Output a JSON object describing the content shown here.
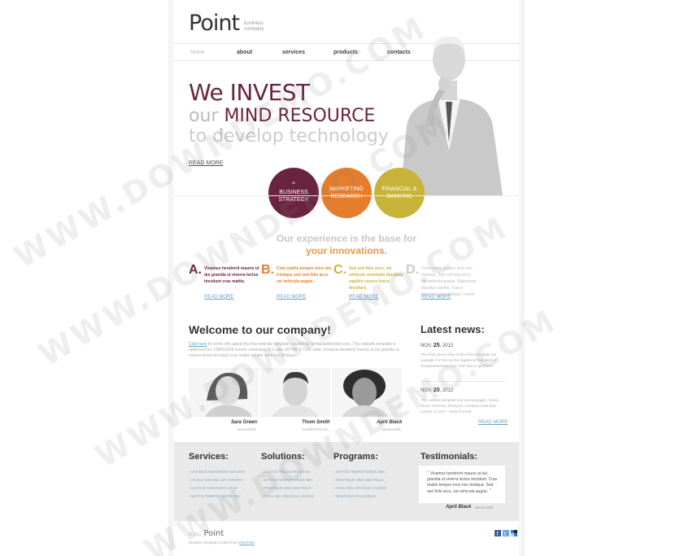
{
  "brand": {
    "name": "Point",
    "tagline": "business company"
  },
  "nav": [
    {
      "label": "home",
      "active": true
    },
    {
      "label": "about"
    },
    {
      "label": "services"
    },
    {
      "label": "products"
    },
    {
      "label": "contacts"
    }
  ],
  "hero": {
    "line1": "We INVEST",
    "line2_light": "our",
    "line2_accent": "MIND RESOURCE",
    "line3": "to develop technology",
    "read_more": "READ MORE"
  },
  "circles": [
    {
      "line1": "BUSINESS",
      "line2": "STRATEGY",
      "color": "#6b2440"
    },
    {
      "line1": "MARKETING",
      "line2": "RESEARCH",
      "color": "#e57e2c"
    },
    {
      "line1": "FINANCIAL &",
      "line2": "BANKING",
      "color": "#c9b23a"
    }
  ],
  "experience": {
    "title_part1": "Our experience is the base for",
    "title_part2": "your innovations.",
    "items": [
      {
        "letter": "A.",
        "text": "Vivamus hendrerit mauris ut dui gravida ut viverra lectus tincidunt cras mattis.",
        "read_more": "READ MORE",
        "color": "#6b2440"
      },
      {
        "letter": "B.",
        "text": "Cras mattis tempor eros nec tristique sed sed felis arcu vel vehicula augue.",
        "read_more": "READ MORE",
        "color": "#e57e2c"
      },
      {
        "letter": "C.",
        "text": "Sed sed felis arcu, vel vehicula venenatis faucibus sagittis cursus fusce tincidunt.",
        "read_more": "READ MORE",
        "color": "#c9b23a"
      },
      {
        "letter": "D.",
        "text": "Cras mattis tempor eros nec tristique. Sed sed felis arcu, vel vehicula augue. Maecenas faucibus lacinia. Fusce tincidunt eget tristique. Lorem.",
        "read_more": "READ MORE",
        "color": "#cccccc"
      }
    ]
  },
  "welcome": {
    "title": "Welcome to our company!",
    "link": "Click here",
    "text": "for more info about this free website template created by TemplateMonster.com. This website template is optimized for 1280X1024 screen resolution. It is also XHTML & CSS valid. Vivamus hendrerit mauris ut dui gravida ut viverra lectus tincidunt cras mattis tempor eros nec tristique."
  },
  "team": [
    {
      "name": "Sara Green",
      "role": "MANAGER"
    },
    {
      "name": "Thom Smith",
      "role": "MARKETOLOG"
    },
    {
      "name": "April Black",
      "role": "MANAGER"
    }
  ],
  "news": {
    "title": "Latest news:",
    "items": [
      {
        "month": "NOV.",
        "day": "25",
        "year": ", 2012",
        "text": "The PSD source files of this Point template are available for free for the registered members of TemplateMonster.com. Feel free to get them!"
      },
      {
        "month": "NOV.",
        "day": "20",
        "year": ", 2012",
        "text": "This website template has several pages: Home, About, Services, Products, Contacts (note that contact us form – doesn't work)."
      }
    ],
    "read_more": "READ MORE"
  },
  "columns": [
    {
      "title": "Services:",
      "items": [
        "VIVAMUS HENDRERIT MAURIS",
        "UT DUI GRAVIDA UT VIVERRA",
        "LECTUS TINCIDUNT CRAS",
        "MATTIS TEMPOR EROS NEC"
      ]
    },
    {
      "title": "Solutions:",
      "items": [
        "LECTUS TINCIDUNT CRAS",
        "MATTIS TEMPOR EROS NEC",
        "TRISTIQUE SED SED FELIS",
        "ARCU VEL VEHICULA AUGUE"
      ]
    },
    {
      "title": "Programs:",
      "items": [
        "MATTIS TEMPOR EROS NEC",
        "TRISTIQUE SED SED FELIS",
        "ARCU VEL VEHICULA AUGUE",
        "MAECENAS FAUCIBUS"
      ]
    }
  ],
  "testimonials": {
    "title": "Testimonials:",
    "quote": "Vivamus hendrerit mauris ut dui gravida ut viverra lectus tincidunt. Cras mattis tempor eros nec tristique. Sed sed felis arcu, vel vehicula augue.",
    "name": "April Black",
    "role": "MANAGER"
  },
  "footer": {
    "copyright": "© 2012",
    "logo": "Point",
    "text": "Website Template Collect from",
    "link": "FEOTEM"
  },
  "watermark": "WWW.DOWNDEMO.COM"
}
